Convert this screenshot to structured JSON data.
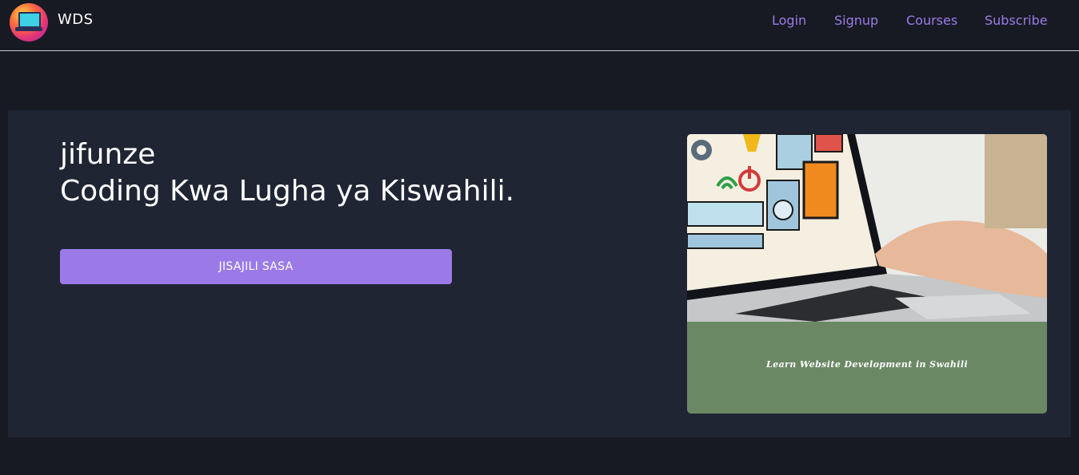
{
  "header": {
    "brand": "WDS",
    "nav": [
      {
        "label": "Login"
      },
      {
        "label": "Signup"
      },
      {
        "label": "Courses"
      },
      {
        "label": "Subscribe"
      }
    ]
  },
  "hero": {
    "line1": "jifunze",
    "line2": "Coding Kwa Lugha ya Kiswahili.",
    "cta_label": "JISAJILI SASA",
    "card_caption": "Learn Website Development in Swahili"
  },
  "colors": {
    "background": "#181a23",
    "hero_panel": "#1f2533",
    "accent": "#9b7ae8",
    "card_band": "#6b8865"
  }
}
